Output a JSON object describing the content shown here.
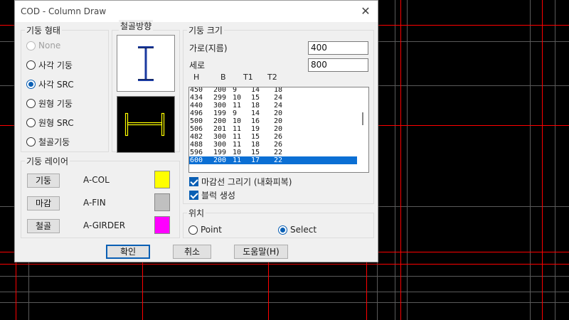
{
  "window": {
    "title": "COD - Column Draw",
    "close_glyph": "✕"
  },
  "column_type": {
    "title": "기둥 형태",
    "options": [
      {
        "label": "None",
        "state": "disabled"
      },
      {
        "label": "사각 기둥",
        "state": "unchecked"
      },
      {
        "label": "사각 SRC",
        "state": "checked"
      },
      {
        "label": "원형 기둥",
        "state": "unchecked"
      },
      {
        "label": "원형 SRC",
        "state": "unchecked"
      },
      {
        "label": "철골기둥",
        "state": "unchecked"
      }
    ]
  },
  "steel_direction": {
    "title": "철골방향"
  },
  "column_layer": {
    "title": "기둥 레이어",
    "rows": [
      {
        "button": "기둥",
        "layer": "A-COL",
        "color": "#ffff00"
      },
      {
        "button": "마감",
        "layer": "A-FIN",
        "color": "#c0c0c0"
      },
      {
        "button": "철골",
        "layer": "A-GIRDER",
        "color": "#ff00ff"
      }
    ]
  },
  "column_size": {
    "title": "기둥 크기",
    "width_label": "가로(지름)",
    "width_value": "400",
    "height_label": "세로",
    "height_value": "800",
    "headers": [
      "H",
      "B",
      "T1",
      "T2"
    ],
    "rows": [
      [
        "450",
        "200",
        "9",
        "14",
        "18"
      ],
      [
        "434",
        "299",
        "10",
        "15",
        "24"
      ],
      [
        "440",
        "300",
        "11",
        "18",
        "24"
      ],
      [
        "496",
        "199",
        "9",
        "14",
        "20"
      ],
      [
        "500",
        "200",
        "10",
        "16",
        "20"
      ],
      [
        "506",
        "201",
        "11",
        "19",
        "20"
      ],
      [
        "482",
        "300",
        "11",
        "15",
        "26"
      ],
      [
        "488",
        "300",
        "11",
        "18",
        "26"
      ],
      [
        "596",
        "199",
        "10",
        "15",
        "22"
      ],
      [
        "600",
        "200",
        "11",
        "17",
        "22"
      ]
    ],
    "selected_row": 9
  },
  "options": {
    "finish_line": {
      "label": "마감선 그리기 (내화피복)",
      "checked": true
    },
    "block": {
      "label": "블럭 생성",
      "checked": true
    }
  },
  "position": {
    "title": "위치",
    "options": [
      {
        "label": "Point",
        "state": "unchecked"
      },
      {
        "label": "Select",
        "state": "checked"
      }
    ]
  },
  "buttons": {
    "ok": "확인",
    "cancel": "취소",
    "help": "도움말(H)"
  },
  "colors": {
    "accent": "#0a5fb4",
    "selection": "#0b6fd4",
    "cad_background": "#000000",
    "cad_grid_red": "#ff0000",
    "cad_grid_gray": "#5a5a5a",
    "steel_preview_white_bg": "#1a3aa0",
    "steel_preview_black_bg": "#ffff00"
  }
}
